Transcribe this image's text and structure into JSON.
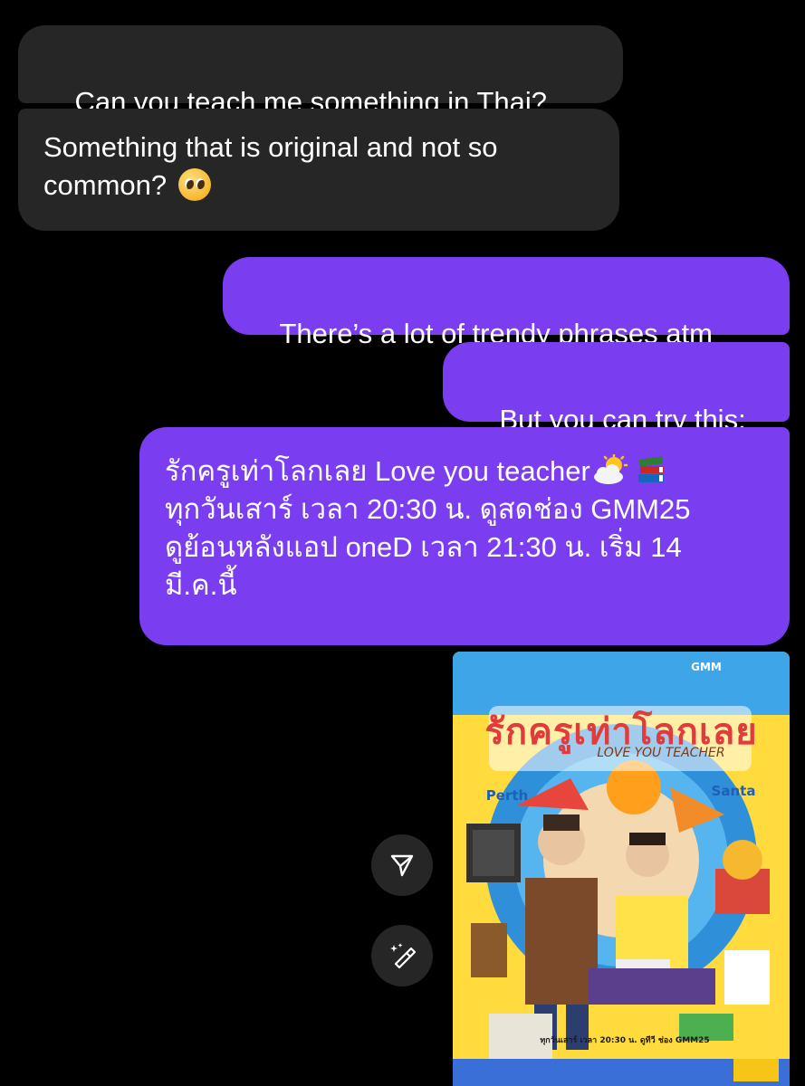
{
  "messages": [
    {
      "id": "b1",
      "direction": "incoming",
      "text": "Can you teach me something in Thai?"
    },
    {
      "id": "b2",
      "direction": "incoming",
      "line1": "Something that is original and not so",
      "line2": "common?",
      "emoji": "pleading-face"
    },
    {
      "id": "b3",
      "direction": "outgoing",
      "text": "There’s a lot of trendy phrases atm"
    },
    {
      "id": "b4",
      "direction": "outgoing",
      "text": "But you can try this:"
    },
    {
      "id": "b5",
      "direction": "outgoing",
      "line1": "รักครูเท่าโลกเลย Love you teacher",
      "line1_emojis": [
        "sun-behind-cloud",
        "books"
      ],
      "line2": "ทุกวันเสาร์ เวลา 20:30 น. ดูสดช่อง GMM25",
      "line3": "ดูย้อนหลังแอป oneD เวลา 21:30 น. เริ่ม 14",
      "line4": "มี.ค.นี้"
    }
  ],
  "side_actions": [
    {
      "name": "share",
      "icon": "paper-plane-icon"
    },
    {
      "name": "ai-edit",
      "icon": "magic-brush-icon"
    }
  ],
  "poster": {
    "title_thai": "รักครูเท่าโลกเลย",
    "title_en": "LOVE YOU TEACHER",
    "name_left": "Perth",
    "name_right": "Santa",
    "brand": "GMM",
    "footer": "ทุกวันเสาร์ เวลา 20:30 น. ดูทีวี ช่อง GMM25"
  },
  "colors": {
    "background": "#000000",
    "incoming_bubble": "#262626",
    "outgoing_bubble": "#7a3df0",
    "text": "#ffffff"
  }
}
